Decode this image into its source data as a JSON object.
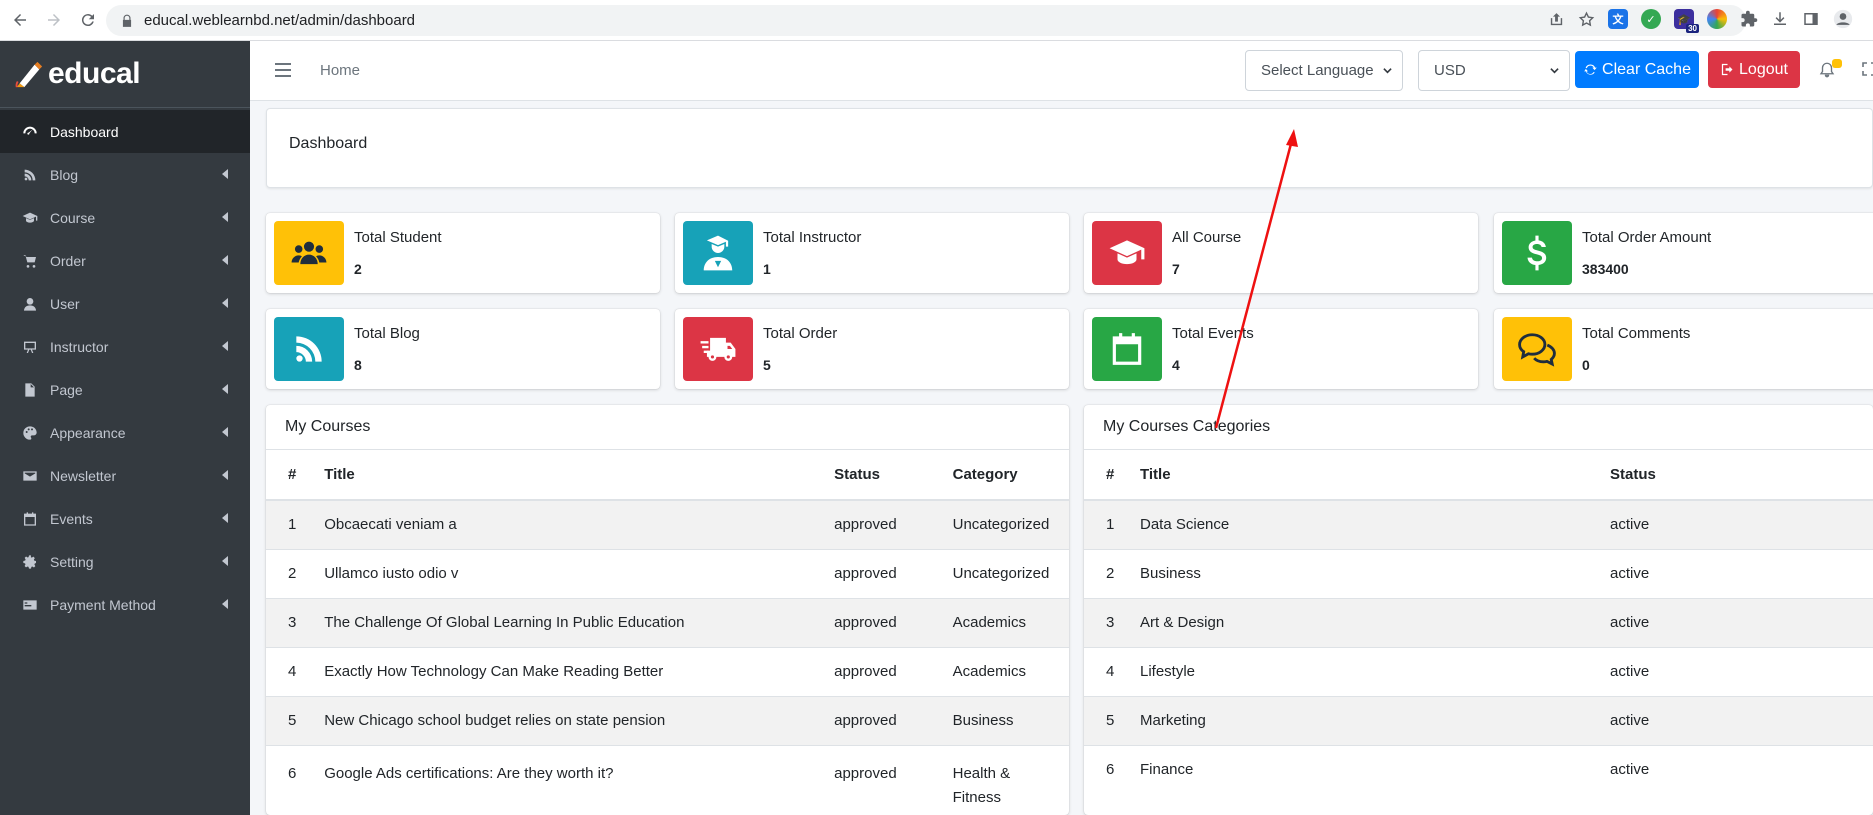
{
  "browser": {
    "url": "educal.weblearnbd.net/admin/dashboard",
    "extension_badge": "30"
  },
  "sidebar": {
    "brand": "educal",
    "items": [
      {
        "label": "Dashboard",
        "icon": "dashboard-icon",
        "active": true,
        "has_caret": false
      },
      {
        "label": "Blog",
        "icon": "blog-icon",
        "active": false,
        "has_caret": true
      },
      {
        "label": "Course",
        "icon": "graduation-cap-icon",
        "active": false,
        "has_caret": true
      },
      {
        "label": "Order",
        "icon": "cart-icon",
        "active": false,
        "has_caret": true
      },
      {
        "label": "User",
        "icon": "user-icon",
        "active": false,
        "has_caret": true
      },
      {
        "label": "Instructor",
        "icon": "chalkboard-icon",
        "active": false,
        "has_caret": true
      },
      {
        "label": "Page",
        "icon": "file-icon",
        "active": false,
        "has_caret": true
      },
      {
        "label": "Appearance",
        "icon": "palette-icon",
        "active": false,
        "has_caret": true
      },
      {
        "label": "Newsletter",
        "icon": "envelope-icon",
        "active": false,
        "has_caret": true
      },
      {
        "label": "Events",
        "icon": "calendar-icon",
        "active": false,
        "has_caret": true
      },
      {
        "label": "Setting",
        "icon": "gear-icon",
        "active": false,
        "has_caret": true
      },
      {
        "label": "Payment Method",
        "icon": "card-icon",
        "active": false,
        "has_caret": true
      }
    ]
  },
  "topbar": {
    "home": "Home",
    "language_select": "Select Language",
    "currency_select": "USD",
    "clear_cache": "Clear Cache",
    "logout": "Logout"
  },
  "page": {
    "title": "Dashboard"
  },
  "stats": [
    {
      "label": "Total Student",
      "value": "2",
      "color": "#ffc107",
      "icon": "users-icon"
    },
    {
      "label": "Total Instructor",
      "value": "1",
      "color": "#17a2b8",
      "icon": "instructor-icon"
    },
    {
      "label": "All Course",
      "value": "7",
      "color": "#dc3545",
      "icon": "graduation-cap-icon"
    },
    {
      "label": "Total Order Amount",
      "value": "383400",
      "color": "#28a745",
      "icon": "dollar-icon"
    },
    {
      "label": "Total Blog",
      "value": "8",
      "color": "#17a2b8",
      "icon": "blog-icon"
    },
    {
      "label": "Total Order",
      "value": "5",
      "color": "#dc3545",
      "icon": "truck-icon"
    },
    {
      "label": "Total Events",
      "value": "4",
      "color": "#28a745",
      "icon": "calendar-icon"
    },
    {
      "label": "Total Comments",
      "value": "0",
      "color": "#ffc107",
      "icon": "comments-icon"
    }
  ],
  "my_courses": {
    "title": "My Courses",
    "columns": [
      "#",
      "Title",
      "Status",
      "Category"
    ],
    "rows": [
      [
        "1",
        "Obcaecati veniam a",
        "approved",
        "Uncategorized"
      ],
      [
        "2",
        "Ullamco iusto odio v",
        "approved",
        "Uncategorized"
      ],
      [
        "3",
        "The Challenge Of Global Learning In Public Education",
        "approved",
        "Academics"
      ],
      [
        "4",
        "Exactly How Technology Can Make Reading Better",
        "approved",
        "Academics"
      ],
      [
        "5",
        "New Chicago school budget relies on state pension",
        "approved",
        "Business"
      ],
      [
        "6",
        "Google Ads certifications: Are they worth it?",
        "approved",
        "Health & Fitness"
      ]
    ]
  },
  "my_categories": {
    "title": "My Courses Categories",
    "columns": [
      "#",
      "Title",
      "Status"
    ],
    "rows": [
      [
        "1",
        "Data Science",
        "active"
      ],
      [
        "2",
        "Business",
        "active"
      ],
      [
        "3",
        "Art & Design",
        "active"
      ],
      [
        "4",
        "Lifestyle",
        "active"
      ],
      [
        "5",
        "Marketing",
        "active"
      ],
      [
        "6",
        "Finance",
        "active"
      ]
    ]
  },
  "colors": {
    "sidebar_bg": "#343a40",
    "primary": "#007bff",
    "danger": "#dc3545",
    "annotation_arrow": "#ee1111"
  }
}
